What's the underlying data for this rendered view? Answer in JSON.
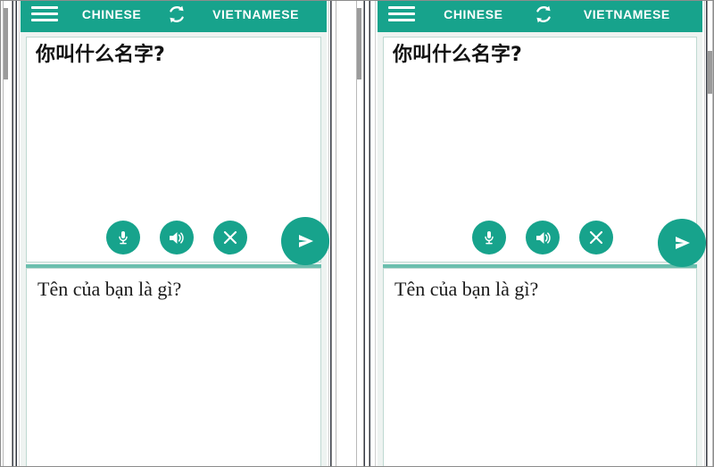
{
  "app": {
    "header": {
      "menu_icon": "hamburger-menu-icon",
      "source_language": "CHINESE",
      "swap_icon": "swap-languages-icon",
      "target_language": "VIETNAMESE",
      "background_color": "#17a38c",
      "text_color": "#ffffff"
    },
    "source_panel": {
      "text": "你叫什么名字?",
      "actions": [
        {
          "name": "microphone",
          "icon": "microphone-icon",
          "label": "Speak"
        },
        {
          "name": "speaker",
          "icon": "speaker-icon",
          "label": "Listen"
        },
        {
          "name": "clear",
          "icon": "close-x-icon",
          "label": "Clear"
        }
      ]
    },
    "send_button": {
      "icon": "send-paper-plane-icon",
      "label": "Translate",
      "color": "#17a38c"
    },
    "target_panel": {
      "text": "Tên của bạn là gì?"
    },
    "theme": {
      "accent": "#17a38c",
      "divider": "#6bbfae",
      "panel_border": "#bfd9d2",
      "app_background": "#eef3f1"
    }
  },
  "devices": [
    {
      "id": "phone-left",
      "label": "Phone screenshot 1"
    },
    {
      "id": "phone-right",
      "label": "Phone screenshot 2"
    }
  ]
}
